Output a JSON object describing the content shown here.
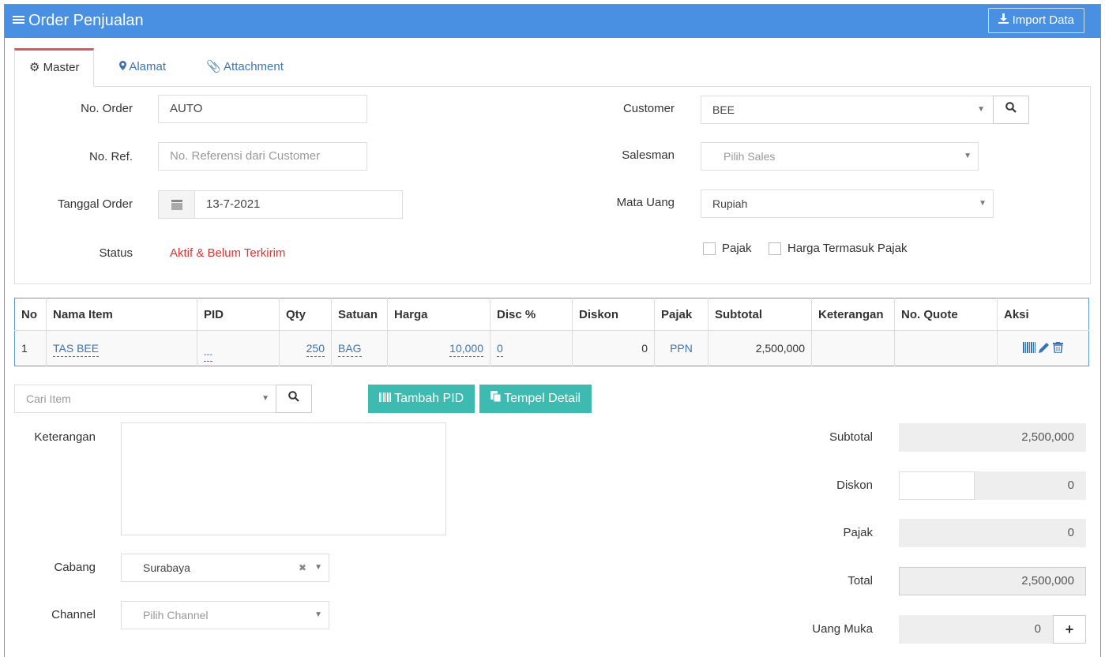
{
  "header": {
    "title": "Order Penjualan",
    "import_label": "Import Data"
  },
  "tabs": [
    {
      "label": "Master",
      "icon": "gears-icon",
      "active": true
    },
    {
      "label": "Alamat",
      "icon": "map-marker-icon",
      "active": false
    },
    {
      "label": "Attachment",
      "icon": "paperclip-icon",
      "active": false
    }
  ],
  "form": {
    "no_order": {
      "label": "No. Order",
      "value": "AUTO"
    },
    "no_ref": {
      "label": "No. Ref.",
      "placeholder": "No. Referensi dari Customer"
    },
    "tanggal": {
      "label": "Tanggal Order",
      "value": "13-7-2021"
    },
    "status": {
      "label": "Status",
      "value": "Aktif & Belum Terkirim"
    },
    "customer": {
      "label": "Customer",
      "value": "BEE"
    },
    "salesman": {
      "label": "Salesman",
      "placeholder": "Pilih Sales"
    },
    "mata_uang": {
      "label": "Mata Uang",
      "value": "Rupiah"
    },
    "pajak_label": "Pajak",
    "harga_termasuk_label": "Harga Termasuk Pajak"
  },
  "table": {
    "columns": [
      "No",
      "Nama Item",
      "PID",
      "Qty",
      "Satuan",
      "Harga",
      "Disc %",
      "Diskon",
      "Pajak",
      "Subtotal",
      "Keterangan",
      "No. Quote",
      "Aksi"
    ],
    "rows": [
      {
        "no": "1",
        "nama": "TAS BEE",
        "pid": "---",
        "qty": "250",
        "satuan": "BAG",
        "harga": "10,000",
        "disc": "0",
        "diskon": "0",
        "pajak": "PPN",
        "subtotal": "2,500,000",
        "keterangan": "",
        "quote": ""
      }
    ]
  },
  "search_item": {
    "placeholder": "Cari Item"
  },
  "buttons": {
    "tambah_pid": "Tambah PID",
    "tempel_detail": "Tempel Detail"
  },
  "keterangan_label": "Keterangan",
  "cabang": {
    "label": "Cabang",
    "value": "Surabaya"
  },
  "channel": {
    "label": "Channel",
    "placeholder": "Pilih Channel"
  },
  "summary": {
    "subtotal": {
      "label": "Subtotal",
      "value": "2,500,000"
    },
    "diskon": {
      "label": "Diskon",
      "value": "0"
    },
    "pajak": {
      "label": "Pajak",
      "value": "0"
    },
    "total": {
      "label": "Total",
      "value": "2,500,000"
    },
    "uang_muka": {
      "label": "Uang Muka",
      "value": "0"
    }
  },
  "colors": {
    "header": "#4a90e2",
    "accent_tab": "#e0555b",
    "status": "#dd3333",
    "teal_button": "#3dbbb0",
    "link": "#3b75b8"
  }
}
